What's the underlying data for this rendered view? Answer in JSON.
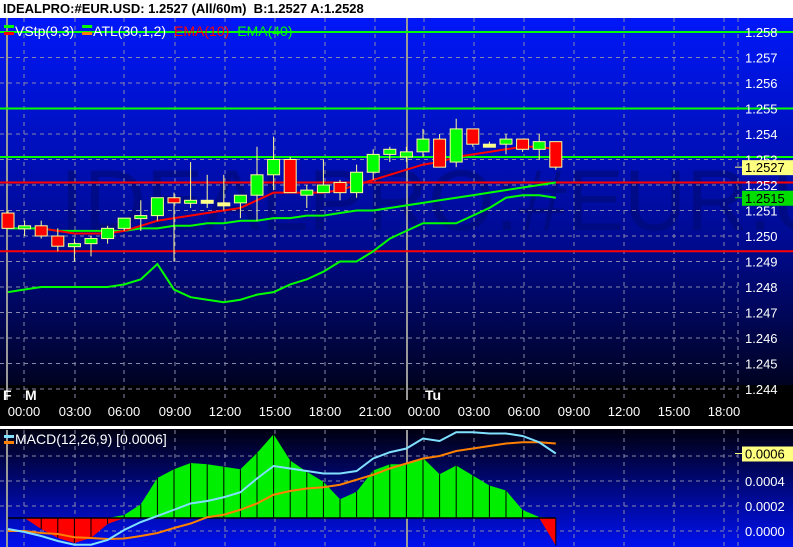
{
  "title": "IDEALPRO:#EUR.USD: 1.2527 (All/60m)  B:1.2527 A:1.2528",
  "watermark": "IDEALPRO:#EUR.USD",
  "legend": [
    {
      "label": "VStp(9,3)",
      "color": "#ffffff",
      "swatch_top": "#00ff00",
      "swatch_bottom": "#ff0000"
    },
    {
      "label": "ATL(30,1,2)",
      "color": "#ffffff",
      "swatch_top": "#00ff00",
      "swatch_bottom": "#ff8000"
    },
    {
      "label": "EMA(10)",
      "color": "#ff0000"
    },
    {
      "label": "EMA(40)",
      "color": "#00ff00"
    }
  ],
  "colors": {
    "up": "#00ff00",
    "down": "#ff0000",
    "doji": "#ffff80",
    "wick": "#ffff99",
    "ema10": "#ff0000",
    "ema40": "#00ff00",
    "vstp": "#00ff00",
    "macd": "#80e0ff",
    "signal": "#ff8000",
    "hist_pos": "#00ee00",
    "hist_neg": "#ff0000"
  },
  "price_axis": {
    "min": 1.244,
    "max": 1.258,
    "ticks": [
      "1.258",
      "1.257",
      "1.256",
      "1.255",
      "1.254",
      "1.253",
      "1.252",
      "1.251",
      "1.250",
      "1.249",
      "1.248",
      "1.247",
      "1.246",
      "1.245",
      "1.244"
    ]
  },
  "horizontal_lines": [
    {
      "price": 1.258,
      "color": "#00ff00"
    },
    {
      "price": 1.255,
      "color": "#00ff00"
    },
    {
      "price": 1.2531,
      "color": "#00ff00"
    },
    {
      "price": 1.2521,
      "color": "#ff0000"
    },
    {
      "price": 1.2494,
      "color": "#ff0000"
    }
  ],
  "price_tags": [
    {
      "label": "1.2527",
      "price": 1.2527,
      "bg": "#ffff80"
    },
    {
      "label": "1.2515",
      "price": 1.2515,
      "bg": "#00dd00"
    }
  ],
  "time_axis": {
    "day_labels": [
      {
        "label": "F",
        "hour": -1
      },
      {
        "label": "M",
        "hour": 0.4
      },
      {
        "label": "Tu",
        "hour": 24.6
      }
    ],
    "labels": [
      "00:00",
      "03:00",
      "06:00",
      "09:00",
      "12:00",
      "15:00",
      "18:00",
      "21:00",
      "00:00",
      "03:00",
      "06:00",
      "09:00",
      "12:00",
      "15:00",
      "18:00"
    ]
  },
  "candles": [
    [
      1.2509,
      1.251,
      1.2503,
      1.2503
    ],
    [
      1.2503,
      1.2506,
      1.25,
      1.2504
    ],
    [
      1.2504,
      1.2506,
      1.2499,
      1.25
    ],
    [
      1.25,
      1.2503,
      1.2494,
      1.2496
    ],
    [
      1.2496,
      1.2499,
      1.249,
      1.2497
    ],
    [
      1.2497,
      1.25,
      1.2492,
      1.2499
    ],
    [
      1.2499,
      1.2504,
      1.2497,
      1.2503
    ],
    [
      1.2503,
      1.2507,
      1.2502,
      1.2507
    ],
    [
      1.2507,
      1.2514,
      1.2502,
      1.2508
    ],
    [
      1.2508,
      1.2515,
      1.2506,
      1.2515
    ],
    [
      1.2515,
      1.2517,
      1.249,
      1.2513
    ],
    [
      1.2513,
      1.2529,
      1.2511,
      1.2514
    ],
    [
      1.2514,
      1.2524,
      1.2511,
      1.2514
    ],
    [
      1.2513,
      1.2524,
      1.251,
      1.2513
    ],
    [
      1.2513,
      1.2516,
      1.2507,
      1.2516
    ],
    [
      1.2516,
      1.2535,
      1.2506,
      1.2524
    ],
    [
      1.2524,
      1.2539,
      1.2518,
      1.253
    ],
    [
      1.253,
      1.2531,
      1.2517,
      1.2517
    ],
    [
      1.2516,
      1.252,
      1.2511,
      1.2518
    ],
    [
      1.2517,
      1.253,
      1.2517,
      1.252
    ],
    [
      1.2521,
      1.2522,
      1.2514,
      1.2517
    ],
    [
      1.2517,
      1.2528,
      1.2515,
      1.2525
    ],
    [
      1.2525,
      1.2534,
      1.2522,
      1.2532
    ],
    [
      1.2532,
      1.2535,
      1.2529,
      1.2534
    ],
    [
      1.2531,
      1.2535,
      1.2529,
      1.2533
    ],
    [
      1.2533,
      1.2542,
      1.2531,
      1.2538
    ],
    [
      1.2538,
      1.254,
      1.2528,
      1.2527
    ],
    [
      1.2529,
      1.2546,
      1.2527,
      1.2542
    ],
    [
      1.2542,
      1.2542,
      1.2535,
      1.2536
    ],
    [
      1.2536,
      1.2537,
      1.2535,
      1.2536
    ],
    [
      1.2536,
      1.254,
      1.2532,
      1.2538
    ],
    [
      1.2538,
      1.2538,
      1.2533,
      1.2534
    ],
    [
      1.2534,
      1.254,
      1.253,
      1.2537
    ],
    [
      1.2537,
      1.2537,
      1.2526,
      1.2527
    ]
  ],
  "ema10": [
    null,
    null,
    1.2503,
    1.2502,
    1.2501,
    1.2501,
    1.2501,
    1.2502,
    1.2504,
    1.2506,
    1.2507,
    1.2508,
    1.2509,
    1.251,
    1.2511,
    1.2514,
    1.2517,
    1.2517,
    1.2517,
    1.2517,
    1.2518,
    1.252,
    1.2522,
    1.2524,
    1.2526,
    1.2528,
    1.2529,
    1.2531,
    1.2532,
    1.2533,
    1.2534,
    1.2535,
    1.2535,
    1.2534
  ],
  "ema40": [
    1.2503,
    1.2503,
    1.2503,
    1.2502,
    1.2502,
    1.2502,
    1.2502,
    1.2502,
    1.2503,
    1.2503,
    1.2504,
    1.2504,
    1.2505,
    1.2505,
    1.2506,
    1.2506,
    1.2507,
    1.2507,
    1.2508,
    1.2508,
    1.2509,
    1.251,
    1.251,
    1.2511,
    1.2512,
    1.2513,
    1.2514,
    1.2515,
    1.2516,
    1.2517,
    1.2518,
    1.2519,
    1.252,
    1.2521
  ],
  "vstp": [
    1.2478,
    1.2479,
    1.248,
    1.248,
    1.248,
    1.248,
    1.248,
    1.2481,
    1.2483,
    1.2489,
    1.2479,
    1.2476,
    1.2475,
    1.2474,
    1.2475,
    1.2477,
    1.2478,
    1.2481,
    1.2483,
    1.2486,
    1.249,
    1.249,
    1.2494,
    1.2499,
    1.2502,
    1.2505,
    1.2505,
    1.2505,
    1.2508,
    1.2511,
    1.2515,
    1.2516,
    1.2516,
    1.2515
  ],
  "macd_panel": {
    "legend": "MACD(12,26,9)  [0.0006]",
    "ticks": [
      "0.0006",
      "0.0004",
      "0.0002",
      "0.0000"
    ],
    "tick_values": [
      0.0006,
      0.0004,
      0.0002,
      0.0
    ],
    "tag": {
      "label": "0.0006",
      "value": 0.00062
    },
    "macd": [
      1.6e-05,
      -8e-06,
      -4e-05,
      -8e-05,
      -0.00011,
      -0.00011,
      -7.2e-05,
      8e-06,
      7.2e-05,
      0.00012,
      0.00017,
      0.00022,
      0.00024,
      0.00027,
      0.00031,
      0.00042,
      0.00052,
      0.0005,
      0.00048,
      0.00046,
      0.00046,
      0.00048,
      0.00058,
      0.00063,
      0.00066,
      0.00074,
      0.00072,
      0.00079,
      0.00079,
      0.00078,
      0.00078,
      0.00076,
      0.00071,
      0.00062
    ],
    "signal": [
      0,
      0,
      -1.6e-05,
      -2.4e-05,
      -5e-05,
      -5.6e-05,
      -6.4e-05,
      -6e-05,
      -4e-05,
      -1.6e-05,
      2.4e-05,
      6e-05,
      0.00011,
      0.00013,
      0.00017,
      0.00022,
      0.00029,
      0.00032,
      0.00034,
      0.00035,
      0.00037,
      0.00041,
      0.00045,
      0.0005,
      0.00054,
      0.00058,
      0.0006,
      0.00064,
      0.00066,
      0.00068,
      0.0007,
      0.00071,
      0.00071,
      0.0007
    ],
    "histogram": [
      0,
      0,
      -8.8e-05,
      -0.00016,
      -0.0002,
      -0.00016,
      -4.8e-05,
      2.4e-05,
      0.00011,
      0.00032,
      0.00039,
      0.00044,
      0.00043,
      0.00041,
      0.00039,
      0.00052,
      0.00067,
      0.00046,
      0.00037,
      0.00029,
      0.00015,
      0.00021,
      0.00038,
      0.00043,
      0.00043,
      0.00048,
      0.00035,
      0.00042,
      0.00034,
      0.00026,
      0.00022,
      6.4e-05,
      8e-06,
      -0.00022
    ]
  }
}
